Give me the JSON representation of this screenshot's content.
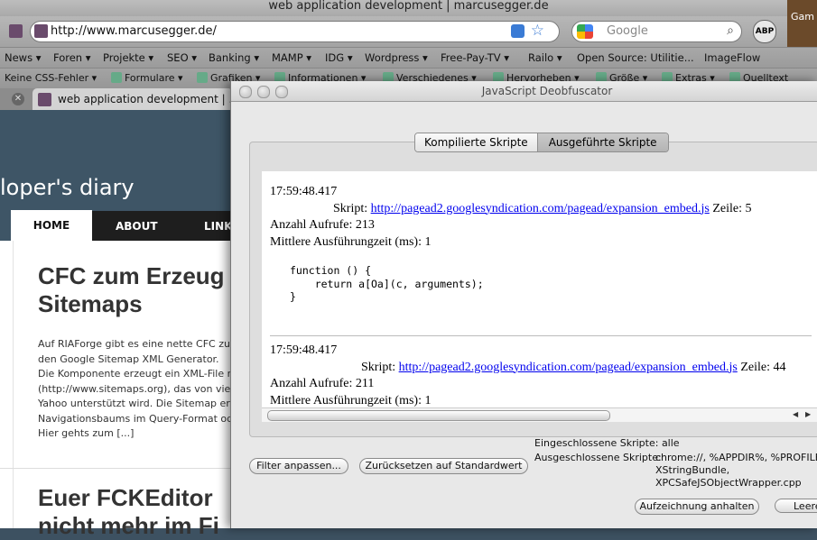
{
  "browser": {
    "window_title": "web application development | marcusegger.de",
    "url": "http://www.marcusegger.de/",
    "search_placeholder": "Google",
    "abp_label": "ABP",
    "game_label": "Gam",
    "bookmarks": [
      "News ▾",
      "Foren ▾",
      "Projekte ▾",
      "SEO ▾",
      "Banking ▾",
      "MAMP ▾",
      "IDG ▾",
      "Wordpress ▾",
      "Free-Pay-TV ▾",
      "Railo ▾",
      "Open Source: Utilitie...",
      "ImageFlow"
    ],
    "toolbar2": [
      "Keine CSS-Fehler ▾",
      "Formulare ▾",
      "Grafiken ▾",
      "Informationen ▾",
      "Verschiedenes ▾",
      "Hervorheben ▾",
      "Größe ▾",
      "Extras ▾",
      "Quelltext"
    ],
    "tab_label": "web application development | ..."
  },
  "site": {
    "tagline": "loper's diary",
    "nav": {
      "home": "HOME",
      "about": "ABOUT",
      "link": "LINK"
    },
    "post1_title": [
      "CFC zum Erzeug",
      "Sitemaps"
    ],
    "post1_body": [
      "Auf RIAForge gibt es eine nette CFC zu",
      "den Google Sitemap XML Generator.",
      "Die Komponente erzeugt ein XML-File n",
      "(http://www.sitemaps.org), das von vieler",
      "Yahoo unterstützt wird. Die Sitemap ergi",
      "Navigationsbaums im Query-Format ode",
      "Hier gehts zum [...]"
    ],
    "post2_title": [
      "Euer FCKEditor",
      "nicht mehr im Fi"
    ]
  },
  "dialog": {
    "title": "JavaScript Deobfuscator",
    "tabs": {
      "compiled": "Kompilierte Skripte",
      "executed": "Ausgeführte Skripte"
    },
    "entries": [
      {
        "time": "17:59:48.417",
        "skript_label": "Skript:",
        "url": "http://pagead2.googlesyndication.com/pagead/expansion_embed.js",
        "line": "Zeile: 5",
        "calls": "Anzahl Aufrufe: 213",
        "avg": "Mittlere Ausführungzeit (ms): 1",
        "code": "function () {\n    return a[Oa](c, arguments);\n}"
      },
      {
        "time": "17:59:48.417",
        "skript_label": "Skript:",
        "url": "http://pagead2.googlesyndication.com/pagead/expansion_embed.js",
        "line": "Zeile: 44",
        "calls": "Anzahl Aufrufe: 211",
        "avg": "Mittlere Ausführungzeit (ms): 1"
      }
    ],
    "buttons": {
      "filter": "Filter anpassen...",
      "reset": "Zurücksetzen auf Standardwert",
      "stop": "Aufzeichnung anhalten",
      "clear": "Leere"
    },
    "included_label": "Eingeschlossene Skripte:",
    "included_value": "alle",
    "excluded_label": "Ausgeschlossene Skripte:",
    "excluded_values": [
      "chrome://, %APPDIR%, %PROFILED",
      "XStringBundle,",
      "XPCSafeJSObjectWrapper.cpp"
    ]
  }
}
